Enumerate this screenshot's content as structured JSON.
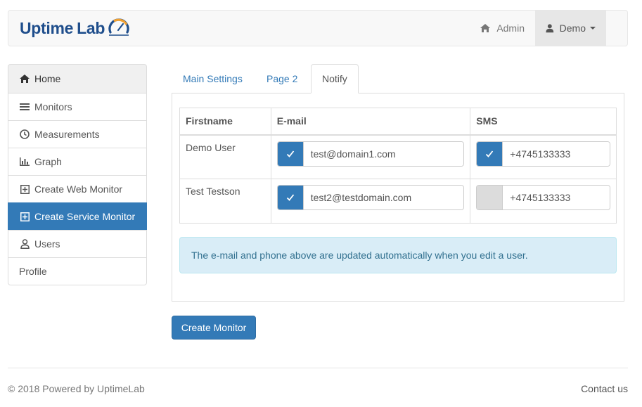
{
  "brand": {
    "name_part1": "Uptime",
    "name_part2": "Lab",
    "logo_icon": "speedometer-icon",
    "color": "#1f4e8c",
    "accent": "#f0a030"
  },
  "navbar": {
    "items": [
      {
        "label": "Admin",
        "icon": "home-icon"
      },
      {
        "label": "Demo",
        "icon": "user-icon",
        "dropdown": true
      }
    ]
  },
  "sidebar": {
    "items": [
      {
        "label": "Home",
        "icon": "home-icon",
        "active": false
      },
      {
        "label": "Monitors",
        "icon": "list-icon",
        "active": false
      },
      {
        "label": "Measurements",
        "icon": "clock-icon",
        "active": false
      },
      {
        "label": "Graph",
        "icon": "bar-chart-icon",
        "active": false
      },
      {
        "label": "Create Web Monitor",
        "icon": "plus-square-icon",
        "active": false
      },
      {
        "label": "Create Service Monitor",
        "icon": "plus-square-icon",
        "active": true
      },
      {
        "label": "Users",
        "icon": "user-icon",
        "active": false
      },
      {
        "label": "Profile",
        "icon": "",
        "active": false
      }
    ]
  },
  "tabs": [
    {
      "label": "Main Settings",
      "active": false
    },
    {
      "label": "Page 2",
      "active": false
    },
    {
      "label": "Notify",
      "active": true
    }
  ],
  "table": {
    "headers": [
      "Firstname",
      "E-mail",
      "SMS"
    ],
    "rows": [
      {
        "firstname": "Demo User",
        "email": "test@domain1.com",
        "email_checked": true,
        "sms": "+4745133333",
        "sms_checked": true
      },
      {
        "firstname": "Test Testson",
        "email": "test2@testdomain.com",
        "email_checked": true,
        "sms": "+4745133333",
        "sms_checked": false
      }
    ]
  },
  "alert": {
    "text": "The e-mail and phone above are updated automatically when you edit a user."
  },
  "create_button": {
    "label": "Create Monitor"
  },
  "footer": {
    "copyright": "© 2018 Powered by UptimeLab",
    "contact": "Contact us"
  },
  "colors": {
    "primary": "#337ab7",
    "alert_bg": "#d9edf7",
    "alert_text": "#31708f"
  }
}
